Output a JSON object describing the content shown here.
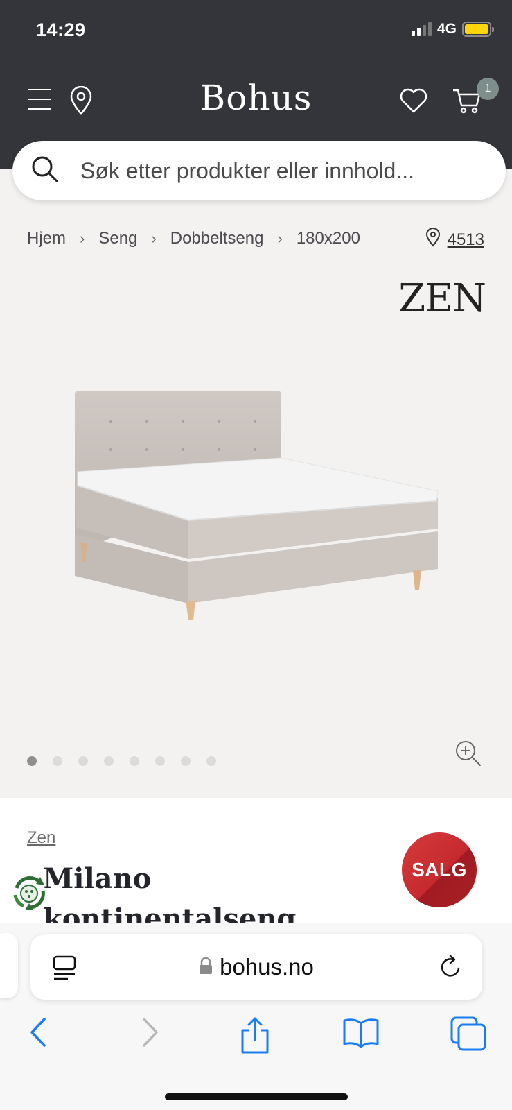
{
  "status_bar": {
    "time": "14:29",
    "network": "4G"
  },
  "header": {
    "logo": "Bohus",
    "cart_count": "1",
    "icons": {
      "menu": "menu-icon",
      "store_locator": "location-pin-icon",
      "favorites": "heart-icon",
      "cart": "shopping-cart-icon"
    }
  },
  "search": {
    "placeholder": "Søk etter produkter eller innhold..."
  },
  "breadcrumb": {
    "items": [
      "Hjem",
      "Seng",
      "Dobbeltseng",
      "180x200"
    ],
    "store_number": "4513"
  },
  "product": {
    "brand_logo": "ZEN",
    "brand_link": "Zen",
    "title_line1": "Milano",
    "title_line2": "kontinentalseng",
    "sale_badge": "SALG",
    "image_count": 8,
    "active_image": 1
  },
  "browser": {
    "url": "bohus.no",
    "icons": [
      "back-icon",
      "forward-icon",
      "share-icon",
      "bookmarks-icon",
      "tabs-icon"
    ]
  },
  "colors": {
    "header_bg": "#34343b",
    "sale_red": "#c52a2f",
    "page_bg": "#f4f2f1",
    "ios_blue": "#1a7cf5"
  }
}
